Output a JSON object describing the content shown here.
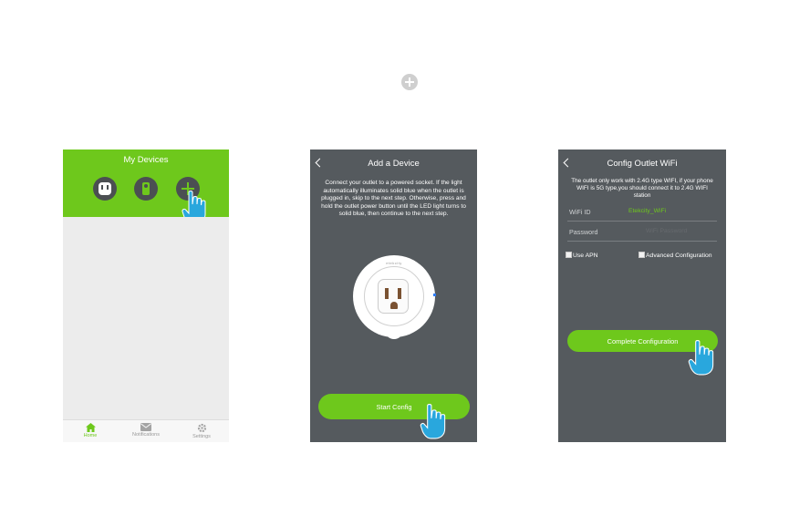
{
  "top": {
    "icon": "plus-circle-icon"
  },
  "phone1": {
    "title": "My Devices",
    "device_icons": [
      "outlet-icon",
      "remote-icon",
      "add-icon"
    ],
    "tabs": [
      {
        "label": "Home",
        "icon": "home-icon",
        "active": true
      },
      {
        "label": "Notifications",
        "icon": "mail-icon",
        "active": false
      },
      {
        "label": "Settings",
        "icon": "gear-icon",
        "active": false
      }
    ]
  },
  "phone2": {
    "title": "Add a Device",
    "description": "Connect your outlet to a powered socket. If the light automatically illuminates solid blue when the outlet is plugged in, skip to the next step. Otherwise, press and hold the outlet power button until the LED light turns to solid blue, then continue to the next step.",
    "plug_brand": "etekcity",
    "button": "Start Config"
  },
  "phone3": {
    "title": "Config Outlet WiFi",
    "description": "The outlet only work with 2.4G type WIFI, if your phone WIFI is 5G type,you should connect it to 2.4G WIFI station",
    "wifi_label": "WiFi ID",
    "wifi_value": "Etekcity_WiFi",
    "password_label": "Password",
    "password_placeholder": "WiFi Password",
    "use_apn": "Use APN",
    "advanced": "Advanced Configuration",
    "button": "Complete Configuration"
  },
  "colors": {
    "accent": "#6ec81c",
    "screen": "#555a5e",
    "icon_dark": "#4b4f52"
  }
}
